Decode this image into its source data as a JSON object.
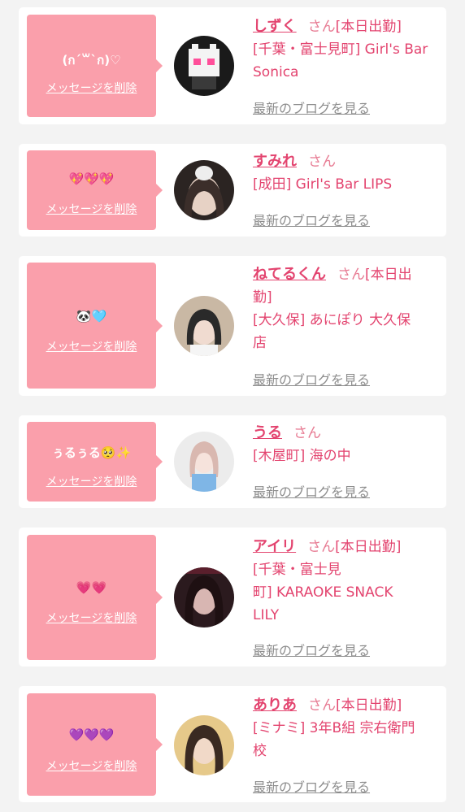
{
  "delete_label": "メッセージを削除",
  "blog_label": "最新のブログを見る",
  "san_label": "さん",
  "colors": {
    "accent": "#e3446f",
    "bubble": "#fa9fab",
    "muted": "#8d8d8d"
  },
  "cards": [
    {
      "message": "(ก´꒳`ก)♡",
      "name": "しずく",
      "status": "[本日出勤]",
      "store_lines": [
        "[千葉・富士見町] Girl's Bar",
        "Sonica"
      ]
    },
    {
      "message": "💖💖💖",
      "name": "すみれ",
      "status": "",
      "store_lines": [
        "[成田] Girl's Bar LIPS"
      ]
    },
    {
      "message": "🐼🩵",
      "name": "ねてるくん",
      "status": "[本日出",
      "status_cont": "勤]",
      "store_lines": [
        "[大久保] あにぽり 大久保",
        "店"
      ]
    },
    {
      "message": "ぅるぅる🥺✨",
      "name": "うる",
      "status": "",
      "store_lines": [
        "[木屋町] 海の中"
      ]
    },
    {
      "message": "💗💗",
      "name": "アイリ",
      "status": "[本日出勤]",
      "store_lines": [
        "[千葉・富士見",
        "町] KARAOKE SNACK",
        "LILY"
      ]
    },
    {
      "message": "💜💜💜",
      "name": "ありあ",
      "status": "[本日出勤]",
      "store_lines": [
        "[ミナミ] 3年B組 宗右衛門",
        "校"
      ]
    }
  ]
}
